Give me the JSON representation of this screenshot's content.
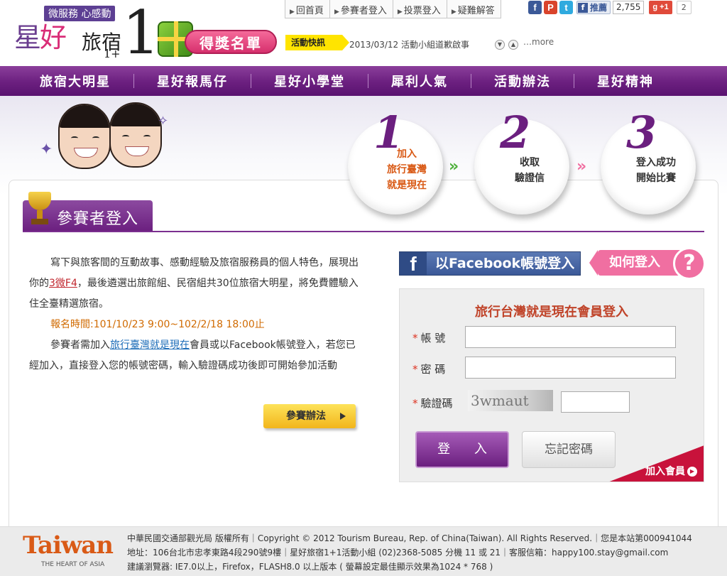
{
  "header": {
    "tagline": "微服務 心感動",
    "logo_main_a": "星",
    "logo_main_b": "好",
    "logo_sub": "旅宿",
    "logo_sub2": "1+",
    "logo_one": "1",
    "award_label": "得獎名單"
  },
  "topnav": [
    {
      "label": "回首頁"
    },
    {
      "label": "參賽者登入"
    },
    {
      "label": "投票登入"
    },
    {
      "label": "疑難解答"
    }
  ],
  "social": {
    "like_label": "推薦",
    "like_count": "2,755",
    "gplus_label": "+1",
    "gplus_count": "2"
  },
  "news": {
    "label": "活動快訊",
    "text": "2013/03/12 活動小組道歉啟事",
    "more": "…more"
  },
  "mainnav": [
    {
      "label": "旅宿大明星"
    },
    {
      "label": "星好報馬仔"
    },
    {
      "label": "星好小學堂"
    },
    {
      "label": "犀利人氣"
    },
    {
      "label": "活動辦法"
    },
    {
      "label": "星好精神"
    }
  ],
  "steps": [
    {
      "num": "1",
      "line1": "加入",
      "line2": "旅行臺灣",
      "line3": "就是現在",
      "color": "#d95a16"
    },
    {
      "num": "2",
      "line1": "收取",
      "line2": "驗證信",
      "line3": "",
      "color": "#333333"
    },
    {
      "num": "3",
      "line1": "登入成功",
      "line2": "開始比賽",
      "line3": "",
      "color": "#333333"
    }
  ],
  "section": {
    "title": "參賽者登入"
  },
  "intro": {
    "p1_a": "寫下與旅客間的互動故事、感動經驗及旅宿服務員的個人特色，展現出你的",
    "p1_hl": "3微F4",
    "p1_b": "，最後遴選出旅館組、民宿組共30位旅宿大明星，將免費體驗入住全臺精選旅宿。",
    "period": "報名時間:101/10/23 9:00~102/2/18 18:00止",
    "p2_a": "參賽者需加入",
    "p2_link": "旅行臺灣就是現在",
    "p2_b": "會員或以Facebook帳號登入，若您已經加入，直接登入您的帳號密碼，輸入驗證碼成功後即可開始參加活動",
    "rules_button": "參賽辦法"
  },
  "facebook_login": "以Facebook帳號登入",
  "howto": "如何登入",
  "login": {
    "title": "旅行台灣就是現在會員登入",
    "account_label": "帳 號",
    "password_label": "密 碼",
    "captcha_label": "驗證碼",
    "captcha_text": "3wmaut",
    "login_button": "登 入",
    "forgot_button": "忘記密碼",
    "join_label": "加入會員"
  },
  "footer": {
    "logo": "Taiwan",
    "logo_sub": "THE HEART OF ASIA",
    "line1": "中華民國交通部觀光局 版權所有｜Copyright © 2012 Tourism Bureau, Rep. of China(Taiwan). All Rights Reserved.｜您是本站第000941044",
    "line2": "地址：106台北市忠孝東路4段290號9樓｜星好旅宿1+1活動小組 (02)2368-5085 分機 11 或 21｜客服信箱：happy100.stay@gmail.com",
    "line3": "建議瀏覽器: IE7.0以上，Firefox，FLASH8.0 以上版本 ( 螢幕設定最佳顯示效果為1024 * 768 )"
  }
}
